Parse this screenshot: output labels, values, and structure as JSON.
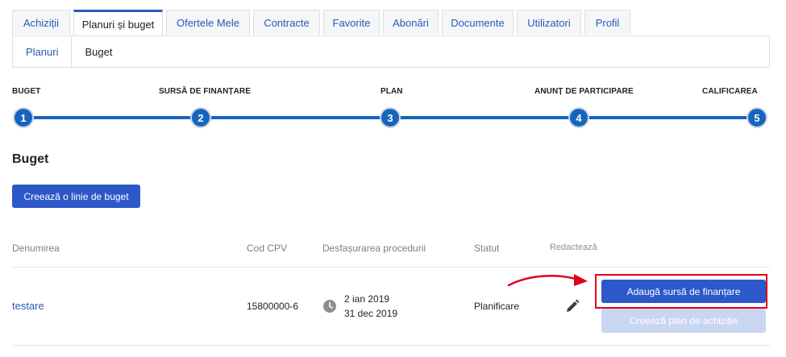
{
  "tabs": [
    {
      "label": "Achiziții"
    },
    {
      "label": "Planuri și buget"
    },
    {
      "label": "Ofertele Mele"
    },
    {
      "label": "Contracte"
    },
    {
      "label": "Favorite"
    },
    {
      "label": "Abonări"
    },
    {
      "label": "Documente"
    },
    {
      "label": "Utilizatori"
    },
    {
      "label": "Profil"
    }
  ],
  "active_tab_index": 1,
  "subtabs": {
    "link": "Planuri",
    "current": "Buget"
  },
  "stepper": {
    "steps": [
      {
        "label": "BUGET",
        "number": "1"
      },
      {
        "label": "SURSĂ DE FINANȚARE",
        "number": "2"
      },
      {
        "label": "PLAN",
        "number": "3"
      },
      {
        "label": "ANUNȚ DE PARTICIPARE",
        "number": "4"
      },
      {
        "label": "CALIFICAREA",
        "number": "5"
      }
    ],
    "color": "#1565c0"
  },
  "section": {
    "title": "Buget",
    "create_button": "Creează o linie de buget"
  },
  "table": {
    "headers": {
      "name": "Denumirea",
      "cpv": "Cod CPV",
      "procedure": "Desfașurarea procedurii",
      "status": "Statut",
      "edit": "Redactează"
    },
    "rows": [
      {
        "name": "testare",
        "cpv": "15800000-6",
        "date_start": "2 ian 2019",
        "date_end": "31 dec 2019",
        "status": "Planificare",
        "edit_icon": "pencil-icon",
        "add_source_button": "Adaugă sursă de finanțare",
        "create_plan_button": "Creează plan de achiziție"
      }
    ]
  },
  "colors": {
    "primary": "#2c58c9",
    "link": "#2c58b8",
    "highlight": "#e0001a",
    "disabled_button": "#c8d6f2"
  }
}
